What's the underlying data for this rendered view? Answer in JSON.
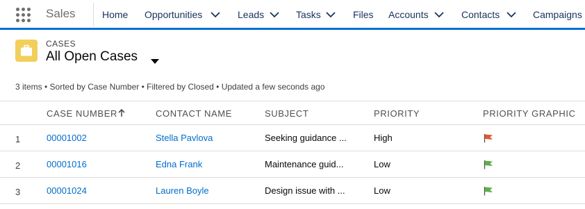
{
  "app": {
    "name": "Sales"
  },
  "nav": {
    "items": [
      {
        "label": "Home",
        "has_menu": false
      },
      {
        "label": "Opportunities",
        "has_menu": true
      },
      {
        "label": "Leads",
        "has_menu": true
      },
      {
        "label": "Tasks",
        "has_menu": true
      },
      {
        "label": "Files",
        "has_menu": false
      },
      {
        "label": "Accounts",
        "has_menu": true
      },
      {
        "label": "Contacts",
        "has_menu": true
      },
      {
        "label": "Campaigns",
        "has_menu": false
      }
    ]
  },
  "header": {
    "object_label": "CASES",
    "list_view": "All Open Cases",
    "meta": "3 items • Sorted by Case Number • Filtered by Closed • Updated a few seconds ago",
    "icon": "briefcase-icon",
    "icon_color": "#f2cf5b"
  },
  "table": {
    "columns": [
      "CASE NUMBER",
      "CONTACT NAME",
      "SUBJECT",
      "PRIORITY",
      "PRIORITY GRAPHIC"
    ],
    "sort_column": "CASE NUMBER",
    "sort_direction": "ascending",
    "rows": [
      {
        "num": "1",
        "case_number": "00001002",
        "contact": "Stella Pavlova",
        "subject": "Seeking guidance ...",
        "priority": "High",
        "flag": "red-flag-icon",
        "flag_color": "#e4572e"
      },
      {
        "num": "2",
        "case_number": "00001016",
        "contact": "Edna Frank",
        "subject": "Maintenance guid...",
        "priority": "Low",
        "flag": "green-flag-icon",
        "flag_color": "#5bb04a"
      },
      {
        "num": "3",
        "case_number": "00001024",
        "contact": "Lauren Boyle",
        "subject": "Design issue with ...",
        "priority": "Low",
        "flag": "green-flag-icon",
        "flag_color": "#5bb04a"
      }
    ]
  },
  "colors": {
    "accent": "#0070d2",
    "link": "#006dcc"
  }
}
